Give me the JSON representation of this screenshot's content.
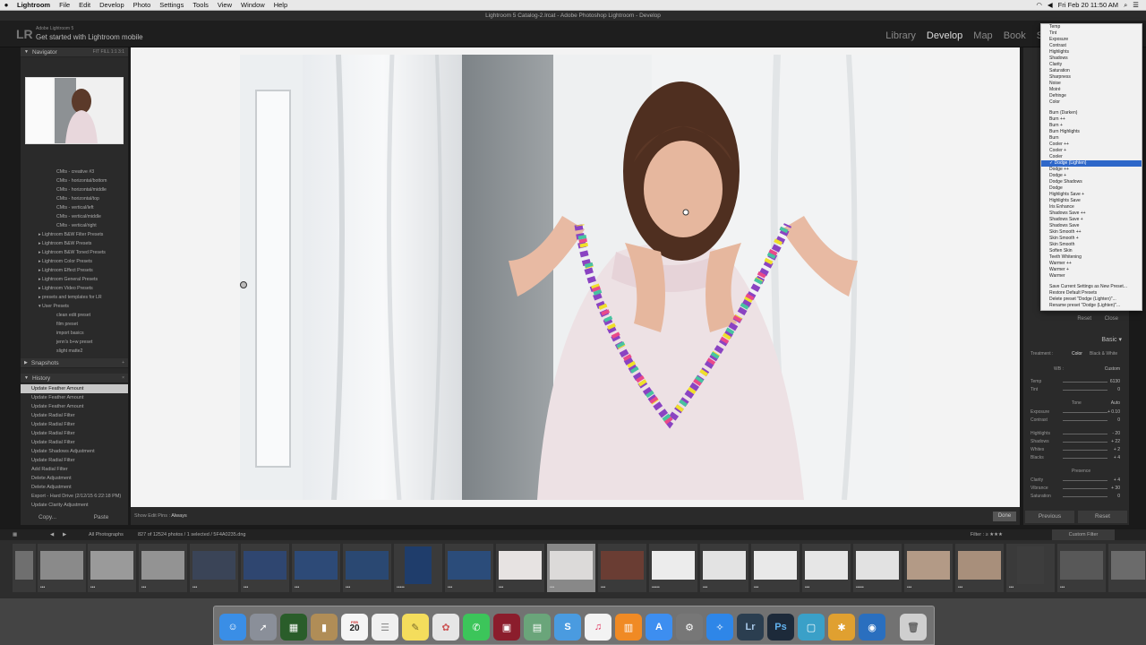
{
  "menubar": {
    "app": "Lightroom",
    "items": [
      "File",
      "Edit",
      "Develop",
      "Photo",
      "Settings",
      "Tools",
      "View",
      "Window",
      "Help"
    ],
    "datetime": "Fri Feb 20  11:50 AM"
  },
  "window_title": "Lightroom 5 Catalog-2.lrcat - Adobe Photoshop Lightroom - Develop",
  "identity": {
    "small": "Adobe Lightroom 5",
    "big": "Get started with Lightroom mobile"
  },
  "modules": [
    "Library",
    "Develop",
    "Map",
    "Book",
    "Sli"
  ],
  "left": {
    "navigator": {
      "title": "Navigator",
      "fit": "FIT",
      "fill": "FILL",
      "r1": "1:1",
      "r3": "3:1"
    },
    "presets": [
      "CMts - creative #3",
      "CMts - horizontal/bottom",
      "CMts - horizontal/middle",
      "CMts - horizontal/top",
      "CMts - vertical/left",
      "CMts - vertical/middle",
      "CMts - vertical/right",
      "Lightroom B&W Filter Presets",
      "Lightroom B&W Presets",
      "Lightroom B&W Toned Presets",
      "Lightroom Color Presets",
      "Lightroom Effect Presets",
      "Lightroom General Presets",
      "Lightroom Video Presets",
      "presets and templates for LR",
      "User Presets",
      "clean edit preset",
      "film preset",
      "import basics",
      "jenn's b+w preset",
      "slight matte2"
    ],
    "snapshots": "Snapshots",
    "history_title": "History",
    "history": [
      "Update Feather Amount",
      "Update Feather Amount",
      "Update Feather Amount",
      "Update Radial Filter",
      "Update Radial Filter",
      "Update Radial Filter",
      "Update Radial Filter",
      "Update Shadows Adjustment",
      "Update Radial Filter",
      "Add Radial Filter",
      "Delete Adjustment",
      "Delete Adjustment",
      "Export - Hard Drive (2/12/15 6:22:18 PM)",
      "Update Clarity Adjustment"
    ],
    "copy": "Copy...",
    "paste": "Paste"
  },
  "toolbar": {
    "label": "Show Edit Pins :",
    "value": "Always",
    "done": "Done"
  },
  "dropdown": {
    "group1": [
      "Temp",
      "Tint",
      "Exposure",
      "Contrast",
      "Highlights",
      "Shadows",
      "Clarity",
      "Saturation",
      "Sharpness",
      "Noise",
      "Moiré",
      "Defringe",
      "Color"
    ],
    "group2": [
      "Burn (Darken)",
      "Burn ++",
      "Burn +",
      "Burn Highlights",
      "Burn",
      "Cooler ++",
      "Cooler +",
      "Cooler",
      "Dodge (Lighten)",
      "Dodge ++",
      "Dodge +",
      "Dodge Shadows",
      "Dodge",
      "Highlights Save +",
      "Highlights Save",
      "Iris Enhance",
      "Shadows Save ++",
      "Shadows Save +",
      "Shadows Save",
      "Skin Smooth ++",
      "Skin Smooth +",
      "Skin Smooth",
      "Soften Skin",
      "Teeth Whitening",
      "Warmer ++",
      "Warmer +",
      "Warmer"
    ],
    "group3": [
      "Save Current Settings as New Preset...",
      "Restore Default Presets",
      "Delete preset \"Dodge (Lighten)\"...",
      "Rename preset \"Dodge (Lighten)\"..."
    ],
    "selected": "Dodge (Lighten)"
  },
  "right": {
    "reset": "Reset",
    "close": "Close",
    "basic": "Basic",
    "treatment": "Treatment :",
    "color": "Color",
    "bw": "Black & White",
    "wb": "WB :",
    "wb_value": "Custom",
    "temp": {
      "label": "Temp",
      "value": "6130"
    },
    "tint": {
      "label": "Tint",
      "value": "0"
    },
    "tone": "Tone",
    "auto": "Auto",
    "exposure": {
      "label": "Exposure",
      "value": "+ 0.10"
    },
    "contrast": {
      "label": "Contrast",
      "value": "0"
    },
    "highlights": {
      "label": "Highlights",
      "value": "- 20"
    },
    "shadows": {
      "label": "Shadows",
      "value": "+ 22"
    },
    "whites": {
      "label": "Whites",
      "value": "+ 2"
    },
    "blacks": {
      "label": "Blacks",
      "value": "+ 4"
    },
    "presence": "Presence",
    "clarity": {
      "label": "Clarity",
      "value": "+ 4"
    },
    "vibrance": {
      "label": "Vibrance",
      "value": "+ 30"
    },
    "saturation": {
      "label": "Saturation",
      "value": "0"
    },
    "previous": "Previous",
    "reset_btn": "Reset"
  },
  "filmstrip": {
    "source": "All Photographs",
    "count": "827 of 12524 photos / 1 selected / 5F4A0235.dng",
    "filter": "Filter :",
    "filter_value": "Custom Filter"
  },
  "dock": {
    "calendar_day": "20",
    "calendar_month": "FEB",
    "lr": "Lr",
    "ps": "Ps"
  }
}
